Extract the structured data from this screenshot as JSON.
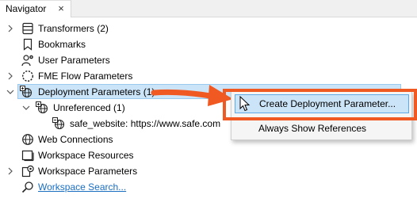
{
  "panel": {
    "title": "Navigator",
    "close_glyph": "×"
  },
  "tree": {
    "items": [
      {
        "label": "Transformers (2)",
        "icon": "transformers-icon",
        "expandable": true,
        "expanded": false
      },
      {
        "label": "Bookmarks",
        "icon": "bookmark-icon",
        "expandable": false
      },
      {
        "label": "User Parameters",
        "icon": "user-parameters-icon",
        "expandable": false
      },
      {
        "label": "FME Flow Parameters",
        "icon": "fme-flow-parameters-icon",
        "expandable": true,
        "expanded": false
      },
      {
        "label": "Deployment Parameters (1)",
        "icon": "deployment-parameters-icon",
        "expandable": true,
        "expanded": true,
        "selected": true
      },
      {
        "label": "Unreferenced (1)",
        "icon": "deployment-parameters-icon",
        "expandable": true,
        "expanded": true
      },
      {
        "label": "safe_website: https://www.safe.com",
        "icon": "deployment-parameter-icon",
        "expandable": false
      },
      {
        "label": "Web Connections",
        "icon": "globe-icon",
        "expandable": false
      },
      {
        "label": "Workspace Resources",
        "icon": "workspace-resources-icon",
        "expandable": false
      },
      {
        "label": "Workspace Parameters",
        "icon": "workspace-parameters-icon",
        "expandable": true,
        "expanded": false
      },
      {
        "label": "Workspace Search...",
        "icon": "search-icon",
        "expandable": false,
        "link": true
      }
    ]
  },
  "context_menu": {
    "items": [
      {
        "label": "Create Deployment Parameter...",
        "highlighted": true
      },
      {
        "label": "Always Show References",
        "highlighted": false
      }
    ]
  },
  "colors": {
    "selection": "#cce4f7",
    "selection_border": "#99c9ef",
    "annotation": "#f05a22",
    "link": "#1a6ec2"
  }
}
